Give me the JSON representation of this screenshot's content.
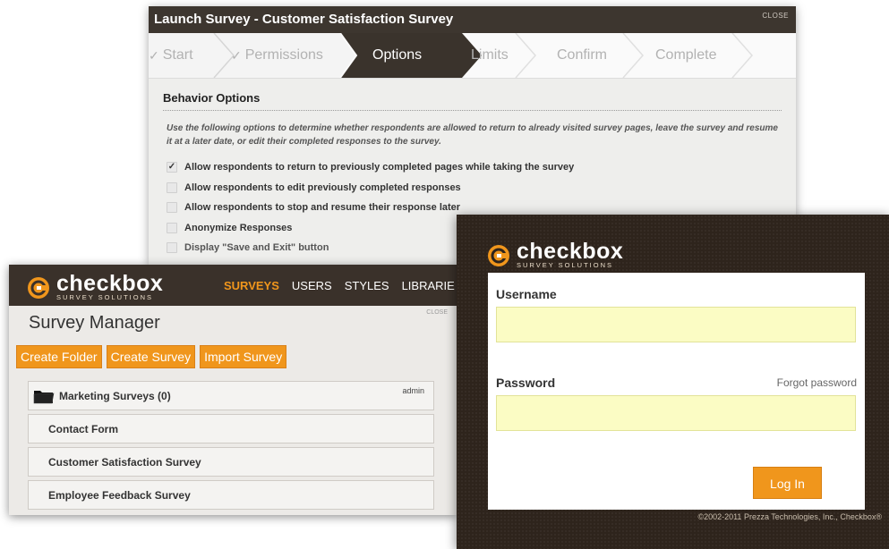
{
  "launch": {
    "title": "Launch Survey - Customer Satisfaction Survey",
    "close_label": "CLOSE",
    "steps": [
      {
        "label": "Start",
        "checked": true
      },
      {
        "label": "Permissions",
        "checked": true
      },
      {
        "label": "Options",
        "active": true
      },
      {
        "label": "Limits"
      },
      {
        "label": "Confirm"
      },
      {
        "label": "Complete"
      }
    ],
    "section_title": "Behavior Options",
    "description": "Use the following options to determine whether respondents are allowed to return to already visited survey pages, leave the survey and resume it at a later date, or edit their completed responses to the survey.",
    "options": [
      {
        "label": "Allow respondents to return to previously completed pages while taking the survey",
        "checked": true
      },
      {
        "label": "Allow respondents to edit previously completed responses",
        "checked": false
      },
      {
        "label": "Allow respondents to stop and resume their response later",
        "checked": false
      },
      {
        "label": "Anonymize Responses",
        "checked": false
      },
      {
        "label": "Display \"Save and Exit\" button",
        "checked": false
      }
    ],
    "checkmark": "✓"
  },
  "manager": {
    "logo": {
      "main": "checkbox",
      "sub": "SURVEY SOLUTIONS"
    },
    "nav": [
      "SURVEYS",
      "USERS",
      "STYLES",
      "LIBRARIE"
    ],
    "close_label": "CLOSE",
    "title": "Survey Manager",
    "buttons": [
      "Create Folder",
      "Create Survey",
      "Import Survey"
    ],
    "folder": {
      "label": "Marketing Surveys (0)",
      "owner": "admin"
    },
    "surveys": [
      "Contact Form",
      "Customer Satisfaction Survey",
      "Employee Feedback Survey"
    ]
  },
  "login": {
    "logo": {
      "main": "checkbox",
      "sub": "SURVEY SOLUTIONS"
    },
    "username_label": "Username",
    "username_value": "",
    "password_label": "Password",
    "password_value": "",
    "forgot_label": "Forgot password",
    "login_button": "Log In",
    "copyright": "©2002-2011 Prezza Technologies, Inc., Checkbox®"
  },
  "colors": {
    "brand_orange": "#f0961c",
    "dark_brown": "#3a312a",
    "input_yellow": "#fbfcc4"
  },
  "icons": [
    "checkmark-icon",
    "folder-icon",
    "checkbox-logo-icon"
  ]
}
